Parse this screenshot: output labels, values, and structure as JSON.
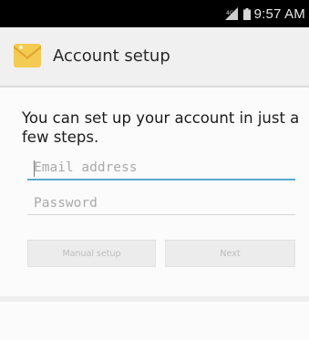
{
  "status_bar": {
    "time": "9:57 AM",
    "icons": [
      "signal-icon",
      "battery-icon"
    ]
  },
  "action_bar": {
    "title": "Account setup",
    "icon": "email-app-icon"
  },
  "content": {
    "intro": "You can set up your account in just a few steps.",
    "email_placeholder": "Email address",
    "email_value": "",
    "password_placeholder": "Password",
    "password_value": "",
    "buttons": {
      "manual_setup": "Manual setup",
      "next": "Next"
    }
  },
  "colors": {
    "focus_underline": "#57a9ce",
    "status_bar_bg": "#000000",
    "action_bar_bg": "#f0f0f0"
  }
}
